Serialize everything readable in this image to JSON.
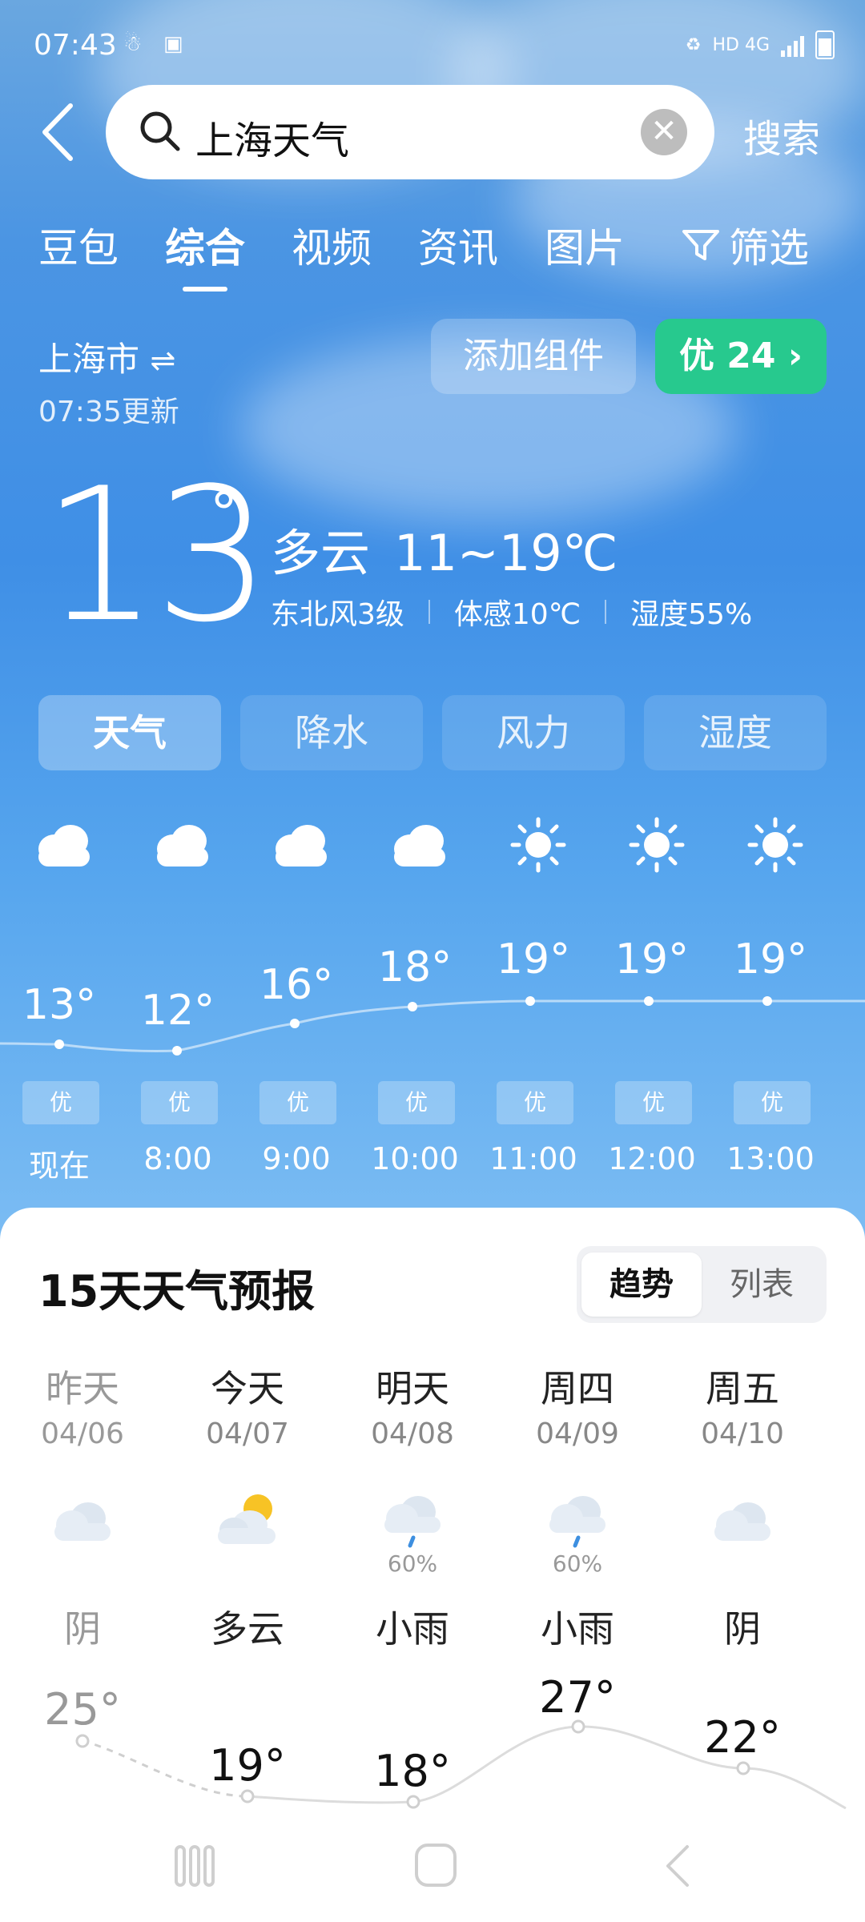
{
  "status_bar": {
    "time": "07:43",
    "right_text": "HD 4G",
    "icons": [
      "notification-icon",
      "app-icon",
      "hd-icon",
      "4g-signal-icon",
      "battery-icon"
    ]
  },
  "search": {
    "query": "上海天气",
    "button": "搜索"
  },
  "tabs": [
    {
      "label": "豆包",
      "active": false
    },
    {
      "label": "综合",
      "active": true
    },
    {
      "label": "视频",
      "active": false
    },
    {
      "label": "资讯",
      "active": false
    },
    {
      "label": "图片",
      "active": false
    },
    {
      "label": "筛选",
      "active": false
    }
  ],
  "location": {
    "city": "上海市",
    "updated": "07:35更新",
    "add_widget": "添加组件",
    "aqi_label": "优 24"
  },
  "current": {
    "temp": "13",
    "degree": "°",
    "condition": "多云",
    "range": "11~19℃",
    "wind": "东北风3级",
    "feels": "体感10℃",
    "humidity": "湿度55%"
  },
  "sub_tabs": [
    {
      "label": "天气",
      "active": true
    },
    {
      "label": "降水",
      "active": false
    },
    {
      "label": "风力",
      "active": false
    },
    {
      "label": "湿度",
      "active": false
    }
  ],
  "hourly": [
    {
      "time": "现在",
      "temp": "13°",
      "aqi": "优",
      "icon": "cloud-icon"
    },
    {
      "time": "8:00",
      "temp": "12°",
      "aqi": "优",
      "icon": "cloud-icon"
    },
    {
      "time": "9:00",
      "temp": "16°",
      "aqi": "优",
      "icon": "cloud-icon"
    },
    {
      "time": "10:00",
      "temp": "18°",
      "aqi": "优",
      "icon": "cloud-icon"
    },
    {
      "time": "11:00",
      "temp": "19°",
      "aqi": "优",
      "icon": "sun-icon"
    },
    {
      "time": "12:00",
      "temp": "19°",
      "aqi": "优",
      "icon": "sun-icon"
    },
    {
      "time": "13:00",
      "temp": "19°",
      "aqi": "优",
      "icon": "sun-icon"
    }
  ],
  "forecast": {
    "title": "15天天气预报",
    "toggle": {
      "trend": "趋势",
      "list": "列表"
    },
    "days": [
      {
        "name": "昨天",
        "date": "04/06",
        "condition": "阴",
        "high": "25°",
        "icon": "overcast-icon",
        "precip": "",
        "past": true
      },
      {
        "name": "今天",
        "date": "04/07",
        "condition": "多云",
        "high": "19°",
        "icon": "partly-cloudy-icon",
        "precip": "",
        "past": false
      },
      {
        "name": "明天",
        "date": "04/08",
        "condition": "小雨",
        "high": "18°",
        "icon": "light-rain-icon",
        "precip": "60%",
        "past": false
      },
      {
        "name": "周四",
        "date": "04/09",
        "condition": "小雨",
        "high": "27°",
        "icon": "light-rain-icon",
        "precip": "60%",
        "past": false
      },
      {
        "name": "周五",
        "date": "04/10",
        "condition": "阴",
        "high": "22°",
        "icon": "overcast-icon",
        "precip": "",
        "past": false
      }
    ]
  },
  "colors": {
    "aqi_green": "#27c98e",
    "sky_blue": "#4b95e3"
  }
}
